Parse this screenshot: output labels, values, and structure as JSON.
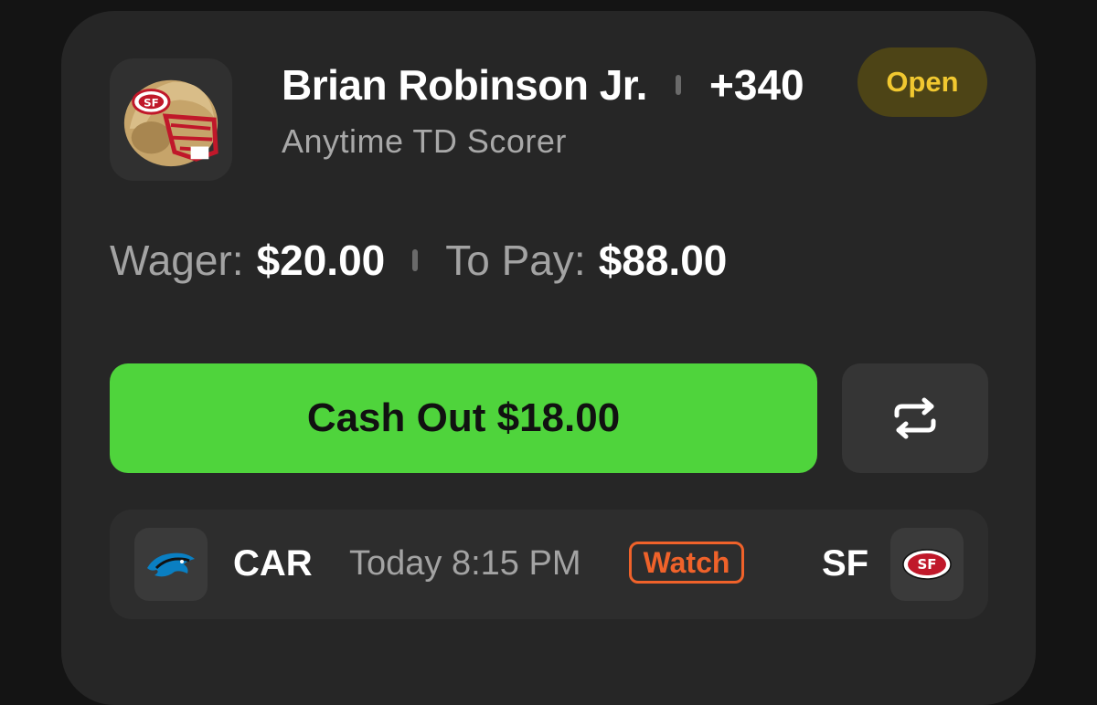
{
  "bet": {
    "player_name": "Brian Robinson Jr.",
    "odds": "+340",
    "status": "Open",
    "market": "Anytime TD Scorer",
    "helmet_icon": "49ers-helmet-icon"
  },
  "amounts": {
    "wager_label": "Wager:",
    "wager_value": "$20.00",
    "topay_label": "To Pay:",
    "topay_value": "$88.00"
  },
  "actions": {
    "cashout_label": "Cash Out $18.00",
    "swap_icon": "repeat-icon"
  },
  "game": {
    "away_team": "CAR",
    "home_team": "SF",
    "time": "Today 8:15 PM",
    "watch_label": "Watch",
    "away_logo": "panthers-logo",
    "home_logo": "49ers-logo"
  },
  "colors": {
    "accent_green": "#4fd43c",
    "status_yellow": "#f1c830",
    "watch_orange": "#f0622a"
  }
}
